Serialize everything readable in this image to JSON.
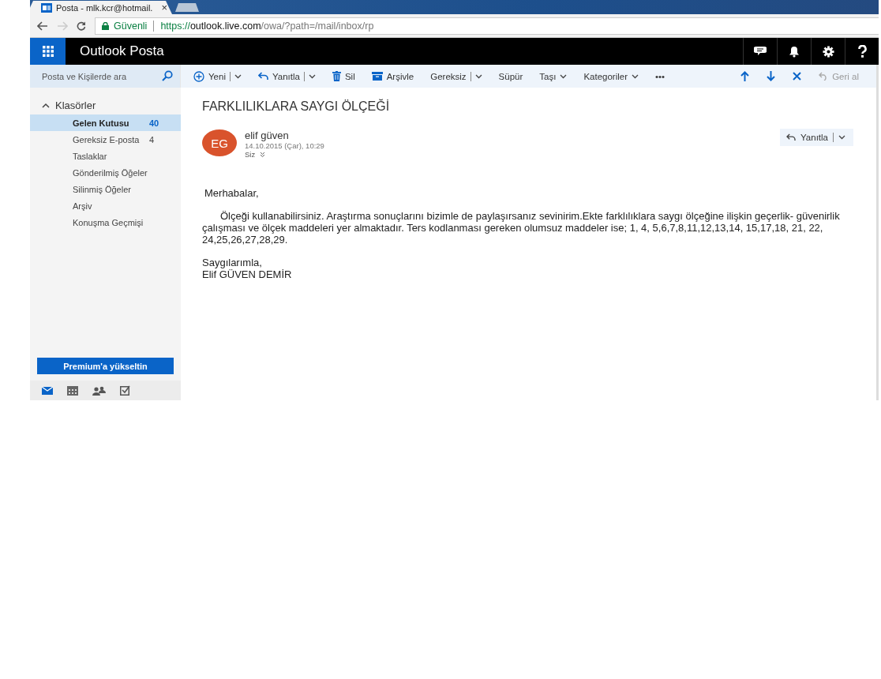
{
  "browser": {
    "tab_title": "Posta - mlk.kcr@hotmail.",
    "tab_close": "×",
    "secure_label": "Güvenli",
    "url_scheme": "https://",
    "url_host": "outlook.live.com",
    "url_path": "/owa/?path=/mail/inbox/rp"
  },
  "header": {
    "title": "Outlook Posta"
  },
  "search": {
    "placeholder": "Posta ve Kişilerde ara"
  },
  "toolbar": [
    {
      "label": "Yeni",
      "kind": "new"
    },
    {
      "label": "Yanıtla",
      "kind": "reply"
    },
    {
      "label": "Sil",
      "kind": "delete"
    },
    {
      "label": "Arşivle",
      "kind": "archive"
    },
    {
      "label": "Gereksiz",
      "kind": "split"
    },
    {
      "label": "Süpür",
      "kind": "plain"
    },
    {
      "label": "Taşı",
      "kind": "menu"
    },
    {
      "label": "Kategoriler",
      "kind": "menu"
    },
    {
      "label": "•••",
      "kind": "plain"
    }
  ],
  "undo": {
    "label": "Geri al",
    "disabled": true
  },
  "folders_header": {
    "label": "Klasörler",
    "expanded": true
  },
  "folders": [
    {
      "name": "Gelen Kutusu",
      "count": "40",
      "selected": true
    },
    {
      "name": "Gereksiz E-posta",
      "count": "4",
      "selected": false
    },
    {
      "name": "Taslaklar",
      "selected": false
    },
    {
      "name": "Gönderilmiş Öğeler",
      "selected": false
    },
    {
      "name": "Silinmiş Öğeler",
      "selected": false
    },
    {
      "name": "Arşiv",
      "selected": false
    },
    {
      "name": "Konuşma Geçmişi",
      "selected": false
    }
  ],
  "upgrade_button": "Premium'a yükseltin",
  "message": {
    "subject": "FARKLILIKLARA SAYGI ÖLÇEĞİ",
    "avatar_initials": "EG",
    "sender": "elif güven",
    "date": "14.10.2015 (Çar), 10:29",
    "to": "Siz",
    "reply_button": "Yanıtla",
    "greeting": "Merhabalar,",
    "paragraph": "Ölçeği kullanabilirsiniz. Araştırma sonuçlarını bizimle de paylaşırsanız sevinirim.Ekte farklılıklara saygı ölçeğine ilişkin geçerlik- güvenirlik çalışması ve ölçek maddeleri yer almaktadır. Ters kodlanması gereken olumsuz maddeler ise; 1, 4, 5,6,7,8,11,12,13,14, 15,17,18, 21, 22, 24,25,26,27,28,29.",
    "signature": [
      "Saygılarımla,",
      "Elif GÜVEN DEMİR"
    ]
  }
}
